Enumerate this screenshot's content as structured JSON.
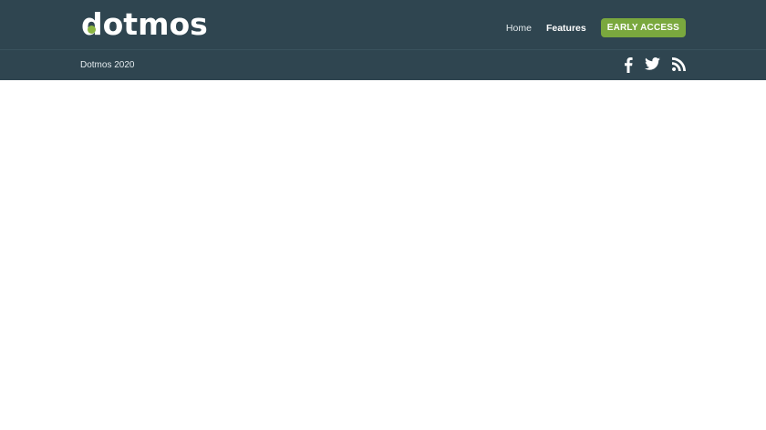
{
  "brand": {
    "logo_text": "dotmos",
    "logo_first_letter": "d",
    "logo_rest": "otmos",
    "colors": {
      "header_bg": "#2f4550",
      "accent": "#7aa83e",
      "logo_dot": "#8bb542"
    }
  },
  "nav": {
    "items": [
      {
        "label": "Home",
        "active": false
      },
      {
        "label": "Features",
        "active": true
      }
    ],
    "cta_label": "EARLY ACCESS"
  },
  "footer_bar": {
    "copyright": "Dotmos 2020",
    "social": [
      {
        "icon": "facebook-icon"
      },
      {
        "icon": "twitter-icon"
      },
      {
        "icon": "rss-icon"
      }
    ]
  }
}
